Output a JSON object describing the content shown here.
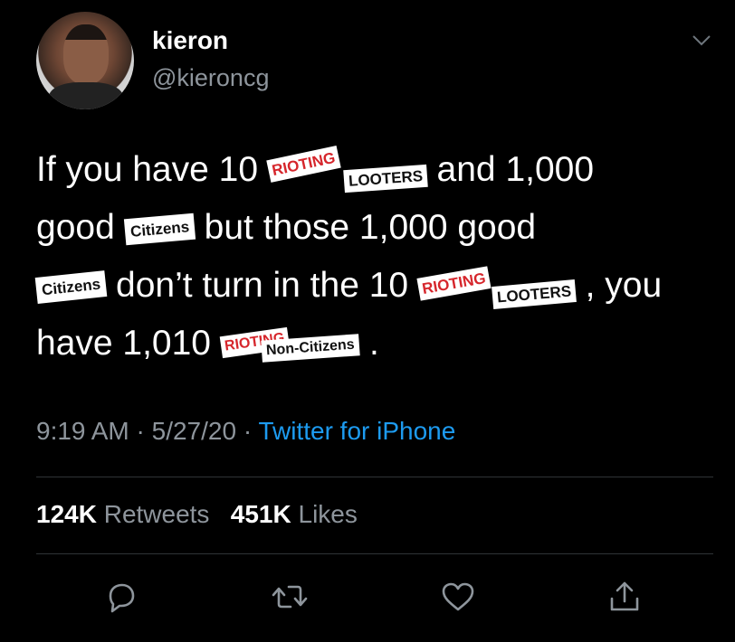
{
  "user": {
    "name": "kieron",
    "handle": "@kieroncg"
  },
  "tweet": {
    "t1": "If you have 10 ",
    "t2": "and 1,000",
    "t3": "good ",
    "t4": " but those 1,000 good",
    "t5": " don’t turn in the 10 ",
    "t6": ", you",
    "t7": "have 1,010",
    "t8": ".",
    "stickers": {
      "rioting": "RIOTING",
      "looters": "LOOTERS",
      "citizens": "Citizens",
      "non_citizens": "Non-Citizens"
    }
  },
  "meta": {
    "time": "9:19 AM",
    "sep": " · ",
    "date": "5/27/20",
    "source": "Twitter for iPhone"
  },
  "stats": {
    "retweets_count": "124K",
    "retweets_label": "Retweets",
    "likes_count": "451K",
    "likes_label": "Likes"
  },
  "icons": [
    "reply-icon",
    "retweet-icon",
    "like-icon",
    "share-icon"
  ],
  "colors": {
    "background": "#000000",
    "text": "#ffffff",
    "muted": "#8e959c",
    "link": "#1d9bf0",
    "sticker_red": "#d6262c"
  }
}
